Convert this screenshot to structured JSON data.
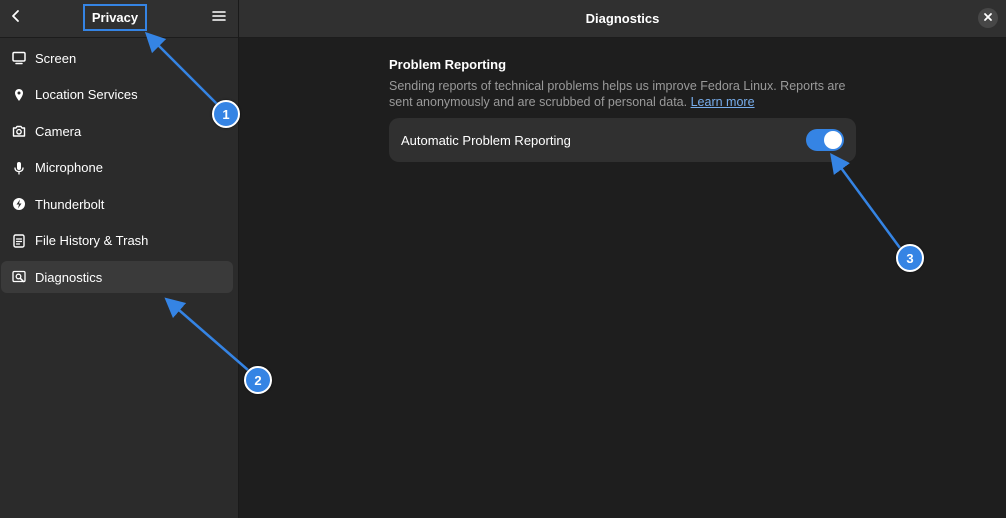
{
  "sidebar": {
    "title": "Privacy",
    "items": [
      {
        "label": "Screen",
        "icon": "display-icon"
      },
      {
        "label": "Location Services",
        "icon": "location-pin-icon"
      },
      {
        "label": "Camera",
        "icon": "camera-icon"
      },
      {
        "label": "Microphone",
        "icon": "microphone-icon"
      },
      {
        "label": "Thunderbolt",
        "icon": "thunderbolt-icon"
      },
      {
        "label": "File History & Trash",
        "icon": "file-history-icon"
      },
      {
        "label": "Diagnostics",
        "icon": "diagnostics-icon",
        "active": true
      }
    ]
  },
  "main": {
    "title": "Diagnostics",
    "section_title": "Problem Reporting",
    "description": "Sending reports of technical problems helps us improve Fedora Linux. Reports are sent anonymously and are scrubbed of personal data.",
    "learn_more": "Learn more",
    "setting": {
      "label": "Automatic Problem Reporting",
      "enabled": true
    }
  },
  "annotations": {
    "badge_1": "1",
    "badge_2": "2",
    "badge_3": "3"
  },
  "colors": {
    "accent": "#3584e4",
    "sidebar_bg": "#2b2b2b",
    "main_bg": "#1e1e1e"
  }
}
